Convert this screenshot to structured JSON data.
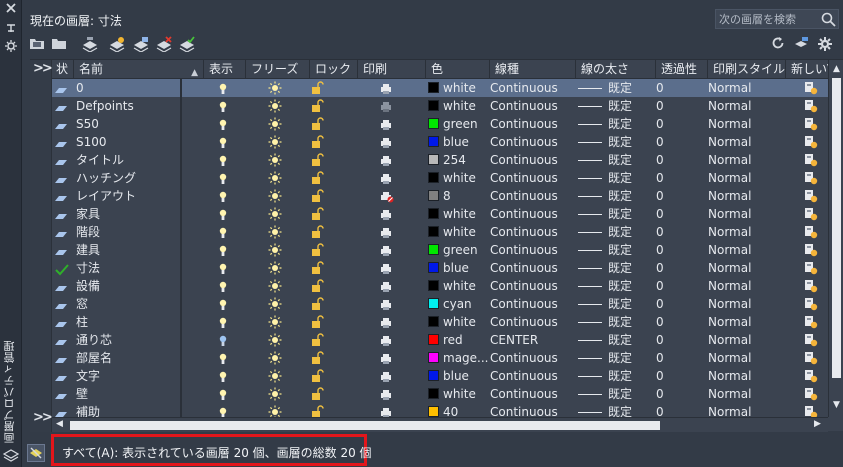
{
  "palette": {
    "title": "画層プロパティ管理"
  },
  "header": {
    "current_layer": "現在の画層: 寸法",
    "search_placeholder": "次の画層を検索"
  },
  "columns": {
    "status": "状",
    "name": "名前",
    "show": "表示",
    "freeze": "フリーズ",
    "lock": "ロック",
    "print": "印刷",
    "color": "色",
    "linetype": "線種",
    "lineweight": "線の太さ",
    "transparency": "透過性",
    "plotstyle": "印刷スタイル",
    "newvp": "新しいVP..."
  },
  "layers": [
    {
      "name": "0",
      "color_name": "white",
      "color": "#000000",
      "linetype": "Continuous",
      "lineweight": "既定",
      "transparency": "0",
      "plotstyle": "Normal",
      "selected": true,
      "current": false,
      "print_off": false,
      "bulb_dim": false
    },
    {
      "name": "Defpoints",
      "color_name": "white",
      "color": "#000000",
      "linetype": "Continuous",
      "lineweight": "既定",
      "transparency": "0",
      "plotstyle": "Normal",
      "selected": false,
      "current": false,
      "print_off": false,
      "bulb_dim": false,
      "print_grey": true
    },
    {
      "name": "S50",
      "color_name": "green",
      "color": "#00e600",
      "linetype": "Continuous",
      "lineweight": "既定",
      "transparency": "0",
      "plotstyle": "Normal",
      "selected": false,
      "current": false,
      "print_off": false,
      "bulb_dim": false
    },
    {
      "name": "S100",
      "color_name": "blue",
      "color": "#0018e8",
      "linetype": "Continuous",
      "lineweight": "既定",
      "transparency": "0",
      "plotstyle": "Normal",
      "selected": false,
      "current": false,
      "print_off": false,
      "bulb_dim": false
    },
    {
      "name": "タイトル",
      "color_name": "254",
      "color": "#b8b8b8",
      "linetype": "Continuous",
      "lineweight": "既定",
      "transparency": "0",
      "plotstyle": "Normal",
      "selected": false,
      "current": false,
      "print_off": false,
      "bulb_dim": false
    },
    {
      "name": "ハッチング",
      "color_name": "white",
      "color": "#000000",
      "linetype": "Continuous",
      "lineweight": "既定",
      "transparency": "0",
      "plotstyle": "Normal",
      "selected": false,
      "current": false,
      "print_off": false,
      "bulb_dim": false
    },
    {
      "name": "レイアウト",
      "color_name": "8",
      "color": "#808080",
      "linetype": "Continuous",
      "lineweight": "既定",
      "transparency": "0",
      "plotstyle": "Normal",
      "selected": false,
      "current": false,
      "print_off": true,
      "bulb_dim": false
    },
    {
      "name": "家具",
      "color_name": "white",
      "color": "#000000",
      "linetype": "Continuous",
      "lineweight": "既定",
      "transparency": "0",
      "plotstyle": "Normal",
      "selected": false,
      "current": false,
      "print_off": false,
      "bulb_dim": false
    },
    {
      "name": "階段",
      "color_name": "white",
      "color": "#000000",
      "linetype": "Continuous",
      "lineweight": "既定",
      "transparency": "0",
      "plotstyle": "Normal",
      "selected": false,
      "current": false,
      "print_off": false,
      "bulb_dim": false
    },
    {
      "name": "建具",
      "color_name": "green",
      "color": "#00e600",
      "linetype": "Continuous",
      "lineweight": "既定",
      "transparency": "0",
      "plotstyle": "Normal",
      "selected": false,
      "current": false,
      "print_off": false,
      "bulb_dim": false
    },
    {
      "name": "寸法",
      "color_name": "blue",
      "color": "#0018e8",
      "linetype": "Continuous",
      "lineweight": "既定",
      "transparency": "0",
      "plotstyle": "Normal",
      "selected": false,
      "current": true,
      "print_off": false,
      "bulb_dim": false
    },
    {
      "name": "設備",
      "color_name": "white",
      "color": "#000000",
      "linetype": "Continuous",
      "lineweight": "既定",
      "transparency": "0",
      "plotstyle": "Normal",
      "selected": false,
      "current": false,
      "print_off": false,
      "bulb_dim": false
    },
    {
      "name": "窓",
      "color_name": "cyan",
      "color": "#00f0f0",
      "linetype": "Continuous",
      "lineweight": "既定",
      "transparency": "0",
      "plotstyle": "Normal",
      "selected": false,
      "current": false,
      "print_off": false,
      "bulb_dim": false
    },
    {
      "name": "柱",
      "color_name": "white",
      "color": "#000000",
      "linetype": "Continuous",
      "lineweight": "既定",
      "transparency": "0",
      "plotstyle": "Normal",
      "selected": false,
      "current": false,
      "print_off": false,
      "bulb_dim": false
    },
    {
      "name": "通り芯",
      "color_name": "red",
      "color": "#ff0000",
      "linetype": "CENTER",
      "lineweight": "既定",
      "transparency": "0",
      "plotstyle": "Normal",
      "selected": false,
      "current": false,
      "print_off": false,
      "bulb_dim": true
    },
    {
      "name": "部屋名",
      "color_name": "mage...",
      "color": "#ff00ff",
      "linetype": "Continuous",
      "lineweight": "既定",
      "transparency": "0",
      "plotstyle": "Normal",
      "selected": false,
      "current": false,
      "print_off": false,
      "bulb_dim": false
    },
    {
      "name": "文字",
      "color_name": "blue",
      "color": "#0018e8",
      "linetype": "Continuous",
      "lineweight": "既定",
      "transparency": "0",
      "plotstyle": "Normal",
      "selected": false,
      "current": false,
      "print_off": false,
      "bulb_dim": false
    },
    {
      "name": "壁",
      "color_name": "white",
      "color": "#000000",
      "linetype": "Continuous",
      "lineweight": "既定",
      "transparency": "0",
      "plotstyle": "Normal",
      "selected": false,
      "current": false,
      "print_off": false,
      "bulb_dim": false
    },
    {
      "name": "補助",
      "color_name": "40",
      "color": "#ffbf00",
      "linetype": "Continuous",
      "lineweight": "既定",
      "transparency": "0",
      "plotstyle": "Normal",
      "selected": false,
      "current": false,
      "print_off": false,
      "bulb_dim": false
    }
  ],
  "status_bar": {
    "text": "すべて(A): 表示されている画層 20 個、画層の総数 20 個"
  },
  "icons": {
    "bulb": "lightbulb-on-icon",
    "sun": "sun-thaw-icon",
    "lock": "padlock-open-icon",
    "print": "printer-icon",
    "vp": "new-vp-freeze-icon"
  }
}
